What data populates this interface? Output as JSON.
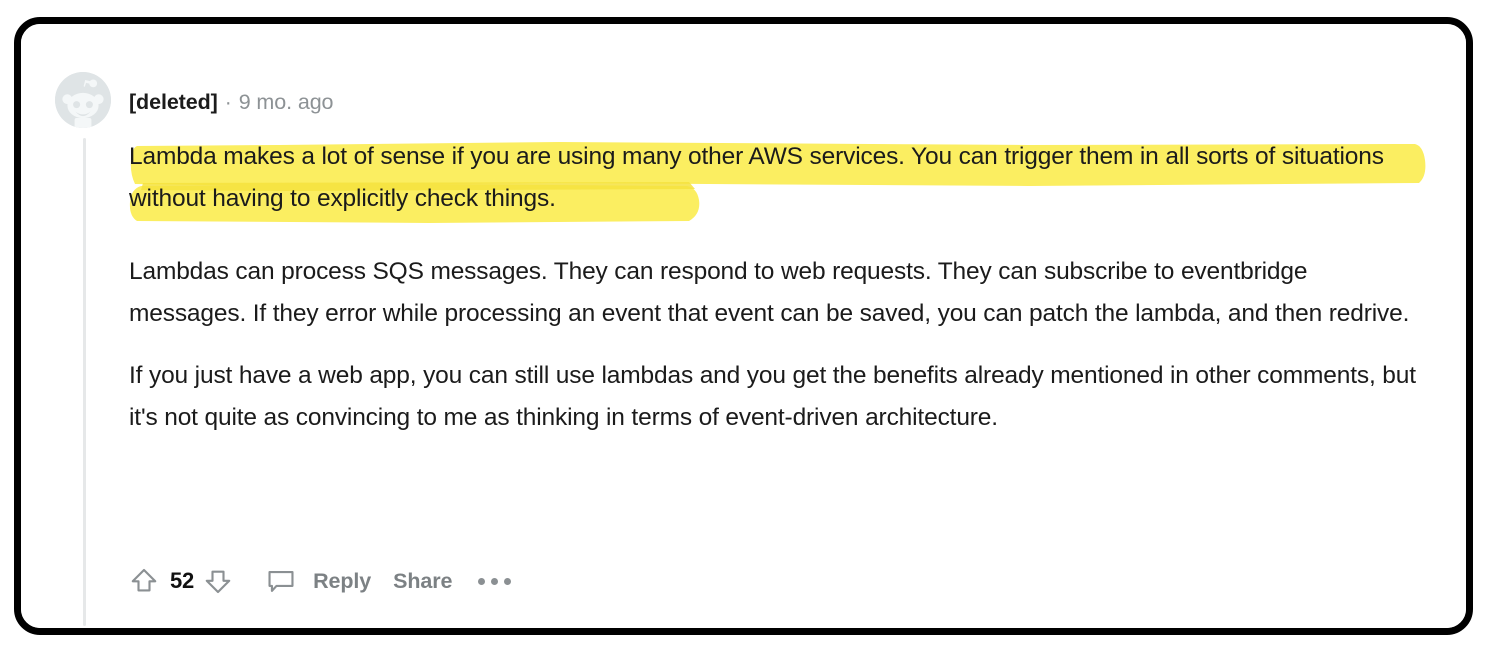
{
  "frame": {
    "border_color": "#000000",
    "background": "#ffffff"
  },
  "comment": {
    "avatar_icon": "reddit-snoo-avatar-icon",
    "author": "[deleted]",
    "separator": "·",
    "timestamp": "9 mo. ago",
    "highlight_color": "#fbee61",
    "highlight_overlap_color": "#f7e23c",
    "paragraphs": [
      {
        "highlighted": true,
        "lines": [
          "Lambda makes a lot of sense if you are using many other AWS services. You can trigger them in",
          "all sorts of situations without having to explicitly check things."
        ],
        "text": "Lambda makes a lot of sense if you are using many other AWS services. You can trigger them in all sorts of situations without having to explicitly check things."
      },
      {
        "highlighted": false,
        "lines": [
          "Lambdas can process SQS messages. They can respond to web requests. They can subscribe to",
          "eventbridge messages. If they error while processing an event that event can be saved, you can",
          "patch the lambda, and then redrive."
        ],
        "text": "Lambdas can process SQS messages. They can respond to web requests. They can subscribe to eventbridge messages. If they error while processing an event that event can be saved, you can patch the lambda, and then redrive."
      },
      {
        "highlighted": false,
        "lines": [
          "If you just have a web app, you can still use lambdas and you get the benefits already mentioned",
          "in other comments, but it's not quite as convincing to me as thinking in terms of event-driven",
          "architecture."
        ],
        "text": "If you just have a web app, you can still use lambdas and you get the benefits already mentioned in other comments, but it's not quite as convincing to me as thinking in terms of event-driven architecture."
      }
    ],
    "actions": {
      "upvote_icon": "upvote-arrow-icon",
      "vote_count": "52",
      "downvote_icon": "downvote-arrow-icon",
      "comment_icon": "speech-bubble-icon",
      "reply_label": "Reply",
      "share_label": "Share",
      "more_icon": "ellipsis-more-icon"
    }
  }
}
